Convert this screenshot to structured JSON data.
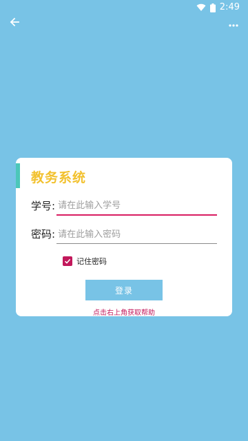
{
  "status_bar": {
    "time": "2:49",
    "icons": [
      "wifi-icon",
      "battery-icon"
    ]
  },
  "toolbar": {
    "back_icon": "arrow-left-icon",
    "more_icon": "more-dots-icon"
  },
  "login_card": {
    "title": "教务系统",
    "student_id_label": "学号:",
    "student_id_placeholder": "请在此输入学号",
    "student_id_value": "",
    "password_label": "密码:",
    "password_placeholder": "请在此输入密码",
    "password_value": "",
    "remember_label": "记住密码",
    "remember_checked": true,
    "login_button": "登录",
    "help_text": "点击右上角获取帮助"
  },
  "colors": {
    "background": "#78c3e6",
    "title": "#f2c12e",
    "accent_bar": "#4cc7b9",
    "focus_underline": "#d81b60",
    "checkbox": "#c2185b",
    "help_text": "#c2185b"
  }
}
